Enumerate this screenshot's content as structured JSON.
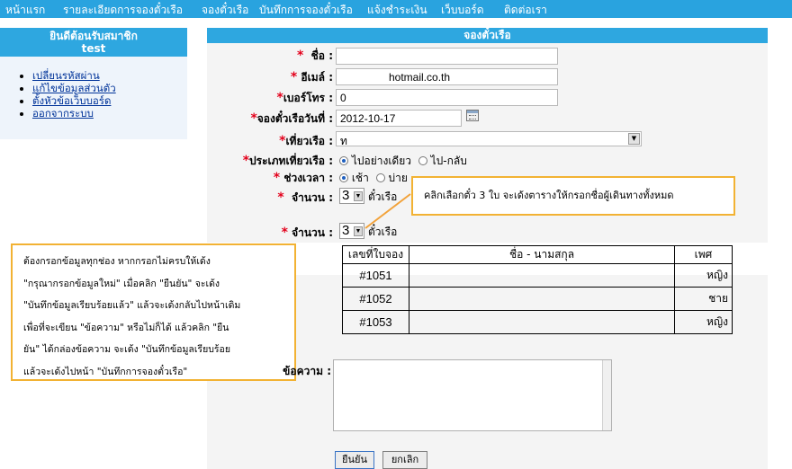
{
  "nav": {
    "items": [
      "หน้าแรก",
      "รายละเอียดการจองตั๋วเรือ",
      "จองตั๋วเรือ",
      "บันทึกการจองตั๋วเรือ",
      "แจ้งชำระเงิน",
      "เว็บบอร์ด",
      "ติดต่อเรา"
    ]
  },
  "sidebar": {
    "welcome": "ยินดีต้อนรับสมาชิก",
    "username": "test",
    "links": [
      "เปลี่ยนรหัสผ่าน",
      "แก้ไขข้อมูลส่วนตัว",
      "ตั้งหัวข้อเว็บบอร์ด",
      "ออกจากระบบ"
    ]
  },
  "form": {
    "title": "จองตั๋วเรือ",
    "name_label": "ชื่อ",
    "name_value": "",
    "email_label": "อีเมล์",
    "email_value": "hotmail.co.th",
    "phone_label": "เบอร์โทร",
    "phone_value": "0",
    "date_label": "จองตั๋วเรือวันที่",
    "date_value": "2012-10-17",
    "trip_label": "เที่ยวเรือ",
    "trip_value": "ท",
    "trip_type_label": "ประเภทเที่ยวเรือ",
    "trip_type_options": [
      "ไปอย่างเดียว",
      "ไป-กลับ"
    ],
    "period_label": "ช่วงเวลา",
    "period_options": [
      "เช้า",
      "บ่าย"
    ],
    "qty_label": "จำนวน",
    "qty_value": "3",
    "qty_unit": "ตั๋วเรือ",
    "message_label": "ข้อความ",
    "confirm_button": "ยืนยัน",
    "cancel_button": "ยกเลิก"
  },
  "table": {
    "headers": [
      "เลขที่ใบจอง",
      "ชื่อ    -    นามสกุล",
      "เพศ"
    ],
    "rows": [
      {
        "num": "#1051",
        "sex": "หญิง"
      },
      {
        "num": "#1052",
        "sex": "ชาย"
      },
      {
        "num": "#1053",
        "sex": "หญิง"
      }
    ]
  },
  "annotations": {
    "callout_top": "คลิกเลือกตั๋ว   3  ใบ    จะเด้งตารางให้กรอกชื่อผู้เดินทางทั้งหมด",
    "callout_left": [
      "ต้องกรอกข้อมูลทุกช่อง   หากกรอกไม่ครบให้เด้ง",
      "\"กรุณากรอกข้อมูลใหม่\"   เมื่อคลิก   \"ยืนยัน\"   จะเด้ง",
      "\"บันทึกข้อมูลเรียบร้อยแล้ว\"   แล้วจะเด้งกลับไปหน้าเดิม",
      "เพื่อที่จะเขียน \"ข้อความ\" หรือไม่ก็ได้   แล้วคลิก  \"ยืน",
      "ยัน\" ได้กล่องข้อความ  จะเด้ง  \"บันทึกข้อมูลเรียบร้อย",
      "แล้วจะเด้งไปหน้า \"บันทึกการจองตั๋วเรือ\""
    ]
  },
  "colors": {
    "nav_bg": "#29a3df",
    "required": "#e3001b",
    "callout_border": "#f2b233",
    "link": "#003399"
  }
}
